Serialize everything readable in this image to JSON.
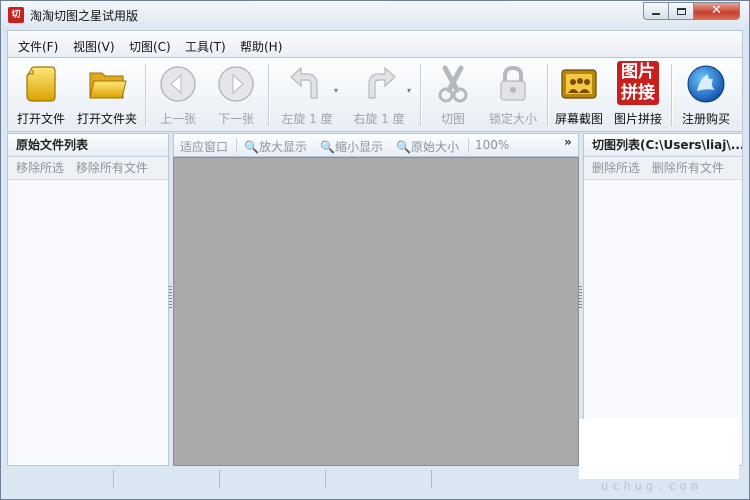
{
  "window": {
    "title": "淘淘切图之星试用版",
    "app_icon_text": "切"
  },
  "menu": [
    "文件(F)",
    "视图(V)",
    "切图(C)",
    "工具(T)",
    "帮助(H)"
  ],
  "toolbar": {
    "open_file": "打开文件",
    "open_folder": "打开文件夹",
    "prev": "上一张",
    "next": "下一张",
    "rotate_left": "左旋 1 度",
    "rotate_right": "右旋 1 度",
    "cut": "切图",
    "lock_size": "锁定大小",
    "screenshot": "屏幕截图",
    "stitch": "图片拼接",
    "stitch_icon_text": "图片拼接",
    "register": "注册购买"
  },
  "left_panel": {
    "title": "原始文件列表",
    "actions": [
      "移除所选",
      "移除所有文件"
    ]
  },
  "right_panel": {
    "title": "切图列表(C:\\Users\\liaj\\...",
    "actions": [
      "删除所选",
      "删除所有文件"
    ]
  },
  "view_bar": {
    "fit": "适应窗口",
    "zoom_in": "放大显示",
    "zoom_out": "缩小显示",
    "original": "原始大小",
    "zoom_level": "100%",
    "more": "»"
  },
  "watermark": "uchug.com",
  "colors": {
    "accent": "#c8201e",
    "canvas": "#a9a9a9",
    "disabled": "#9aa3ad"
  }
}
